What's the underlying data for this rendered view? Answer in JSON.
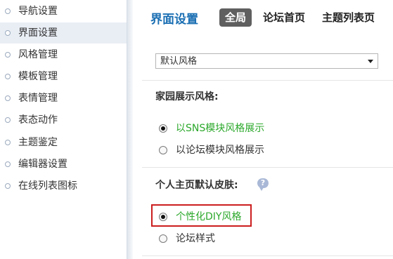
{
  "sidebar": {
    "items": [
      {
        "label": "导航设置",
        "active": false
      },
      {
        "label": "界面设置",
        "active": true
      },
      {
        "label": "风格管理",
        "active": false
      },
      {
        "label": "模板管理",
        "active": false
      },
      {
        "label": "表情管理",
        "active": false
      },
      {
        "label": "表态动作",
        "active": false
      },
      {
        "label": "主题鉴定",
        "active": false
      },
      {
        "label": "编辑器设置",
        "active": false
      },
      {
        "label": "在线列表图标",
        "active": false
      }
    ]
  },
  "header": {
    "title": "界面设置",
    "tabs": [
      {
        "label": "全局",
        "active": true
      },
      {
        "label": "论坛首页",
        "active": false
      },
      {
        "label": "主题列表页",
        "active": false
      }
    ]
  },
  "default_style": {
    "selected": "默认风格"
  },
  "home_style": {
    "title": "家园展示风格:",
    "options": [
      {
        "label": "以SNS模块风格展示",
        "checked": true
      },
      {
        "label": "以论坛模块风格展示",
        "checked": false
      }
    ]
  },
  "personal_skin": {
    "title": "个人主页默认皮肤:",
    "help_icon_text": "?",
    "options": [
      {
        "label": "个性化DIY风格",
        "checked": true
      },
      {
        "label": "论坛样式",
        "checked": false
      }
    ]
  },
  "colors": {
    "accent": "#1b6fb3",
    "highlight": "#cc1e1e",
    "selected_text": "#2ba82b"
  }
}
